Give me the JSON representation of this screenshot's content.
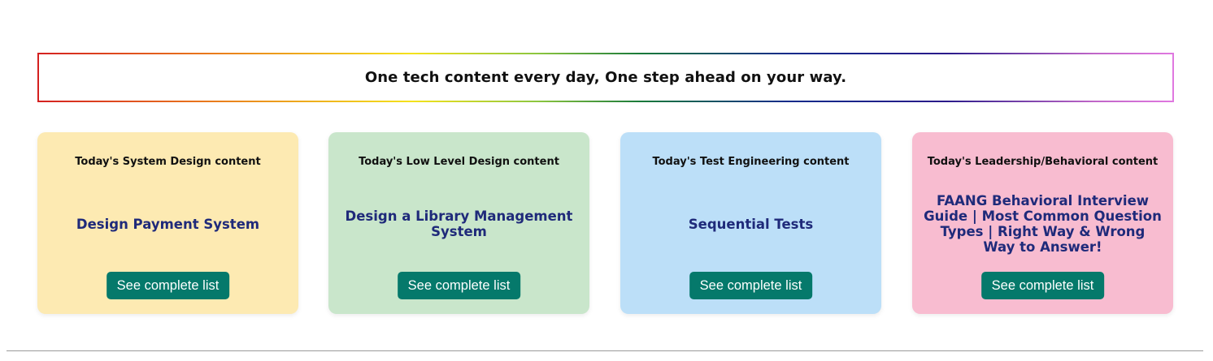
{
  "banner": {
    "text": "One tech content every day, One step ahead on your way."
  },
  "cards": [
    {
      "heading": "Today's System Design content",
      "title": "Design Payment System",
      "button_label": "See complete list",
      "background": "#fdeab2"
    },
    {
      "heading": "Today's Low Level Design content",
      "title": "Design a Library Management System",
      "button_label": "See complete list",
      "background": "#c9e6cb"
    },
    {
      "heading": "Today's Test Engineering content",
      "title": "Sequential Tests",
      "button_label": "See complete list",
      "background": "#bcdff8"
    },
    {
      "heading": "Today's Leadership/Behavioral content",
      "title": "FAANG Behavioral Interview Guide | Most Common Question Types | Right Way & Wrong Way to Answer!",
      "button_label": "See complete list",
      "background": "#f8bcd0"
    }
  ],
  "colors": {
    "title_text": "#1f2a7a",
    "button_bg": "#05796b",
    "button_text": "#ffffff"
  }
}
